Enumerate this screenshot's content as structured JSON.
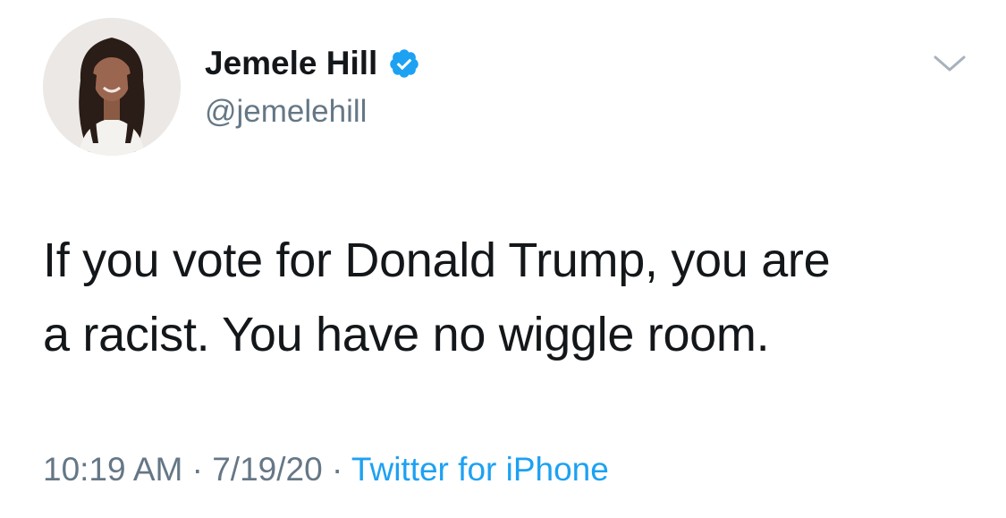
{
  "user": {
    "display_name": "Jemele Hill",
    "handle": "@jemelehill",
    "verified": true
  },
  "tweet": {
    "text_line1": "If you vote for Donald Trump, you are",
    "text_line2": "a racist. You have no wiggle room."
  },
  "meta": {
    "time": "10:19 AM",
    "separator": "·",
    "date": "7/19/20",
    "source": "Twitter for iPhone"
  },
  "colors": {
    "accent": "#1da1f2",
    "verified": "#1da1f2",
    "secondary_text": "#657786",
    "primary_text": "#14171a"
  },
  "icons": {
    "verified": "verified-badge-icon",
    "menu": "chevron-down-icon"
  }
}
